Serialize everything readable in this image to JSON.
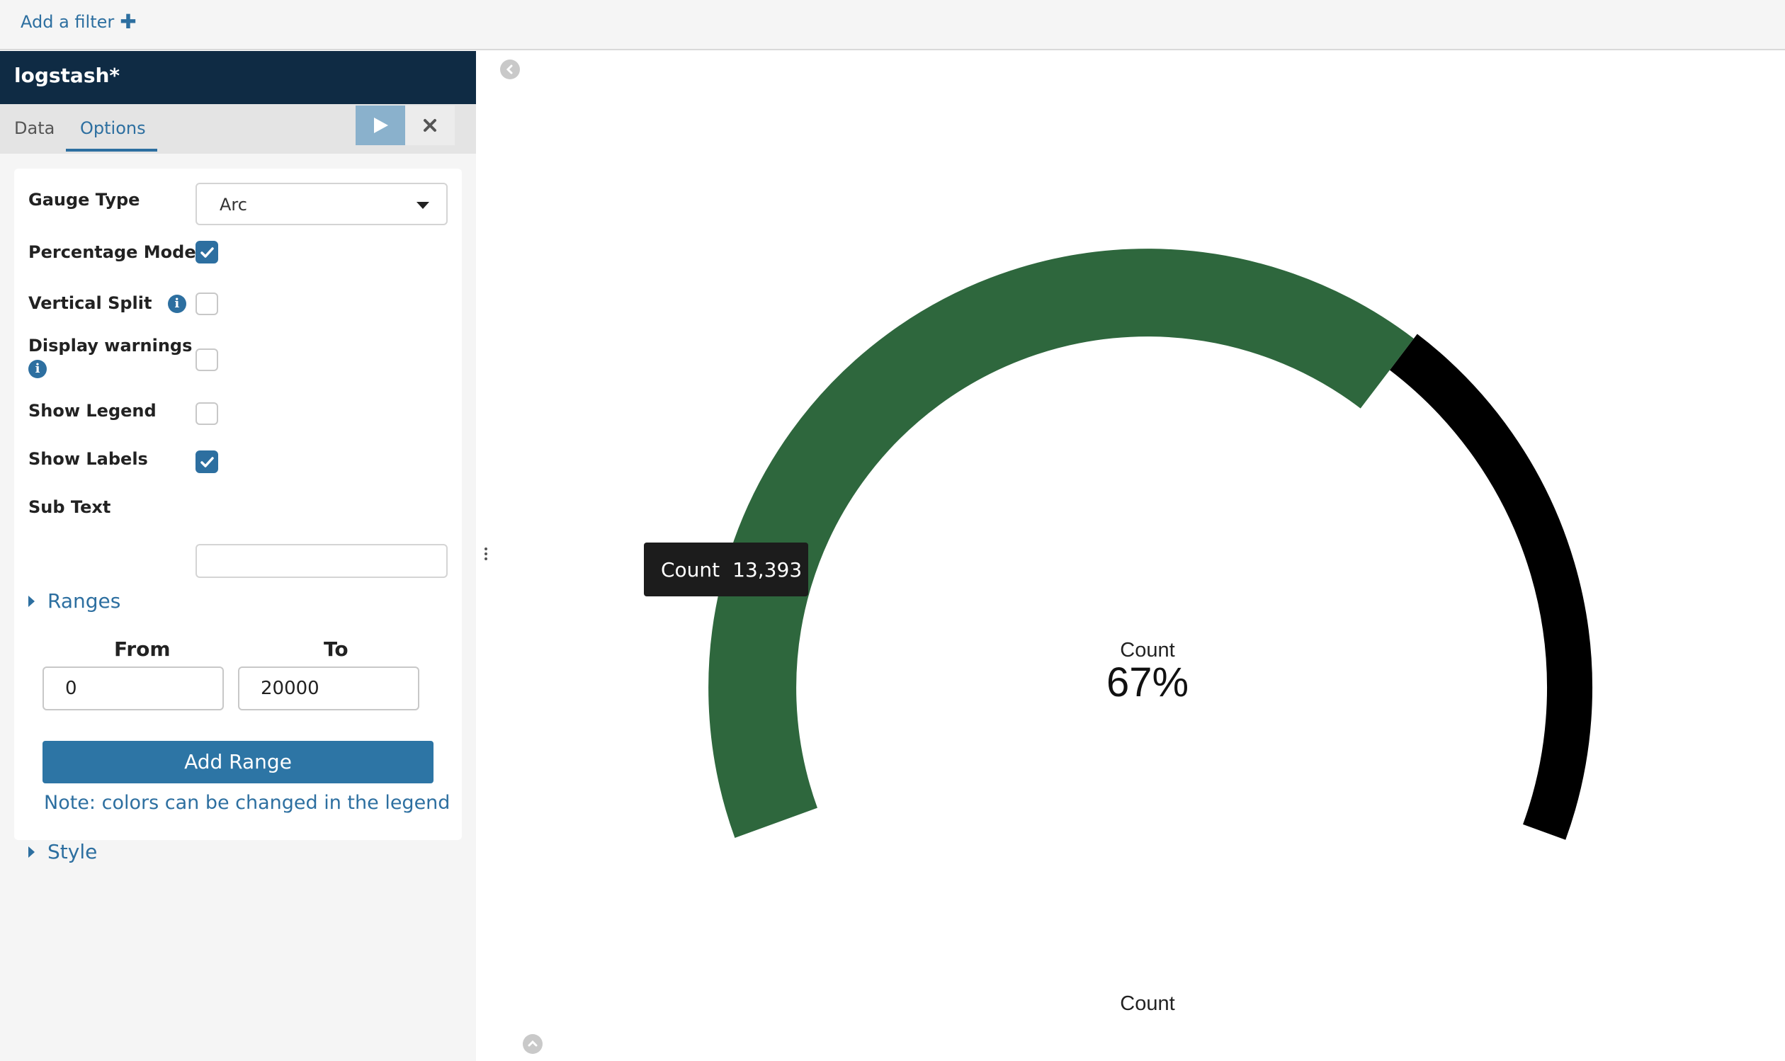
{
  "filter_bar": {
    "add_filter_label": "Add a filter"
  },
  "sidebar": {
    "index_pattern": "logstash*",
    "tabs": [
      {
        "label": "Data"
      },
      {
        "label": "Options"
      }
    ],
    "active_tab": "Options"
  },
  "options": {
    "gauge_type": {
      "label": "Gauge Type",
      "value": "Arc"
    },
    "percentage_mode": {
      "label": "Percentage Mode",
      "checked": true
    },
    "vertical_split": {
      "label": "Vertical Split",
      "checked": false
    },
    "display_warnings": {
      "label": "Display warnings",
      "checked": false
    },
    "show_legend": {
      "label": "Show Legend",
      "checked": false
    },
    "show_labels": {
      "label": "Show Labels",
      "checked": true
    },
    "sub_text": {
      "label": "Sub Text",
      "value": ""
    },
    "ranges_label": "Ranges",
    "from_label": "From",
    "to_label": "To",
    "range_from": "0",
    "range_to": "20000",
    "add_range_label": "Add Range",
    "note": "Note: colors can be changed in the legend",
    "style_label": "Style"
  },
  "colors": {
    "accent": "#2d6fa0",
    "gauge_fill": "#2e673d",
    "gauge_remaining": "#000000",
    "header_bg": "#0f2b44"
  },
  "chart_data": {
    "type": "gauge",
    "gauge_type": "Arc",
    "metric_label": "Count",
    "value": 13393,
    "range_min": 0,
    "range_max": 20000,
    "percent_label": "67%",
    "bottom_label": "Count",
    "tooltip": {
      "label": "Count",
      "value": "13,393"
    }
  }
}
